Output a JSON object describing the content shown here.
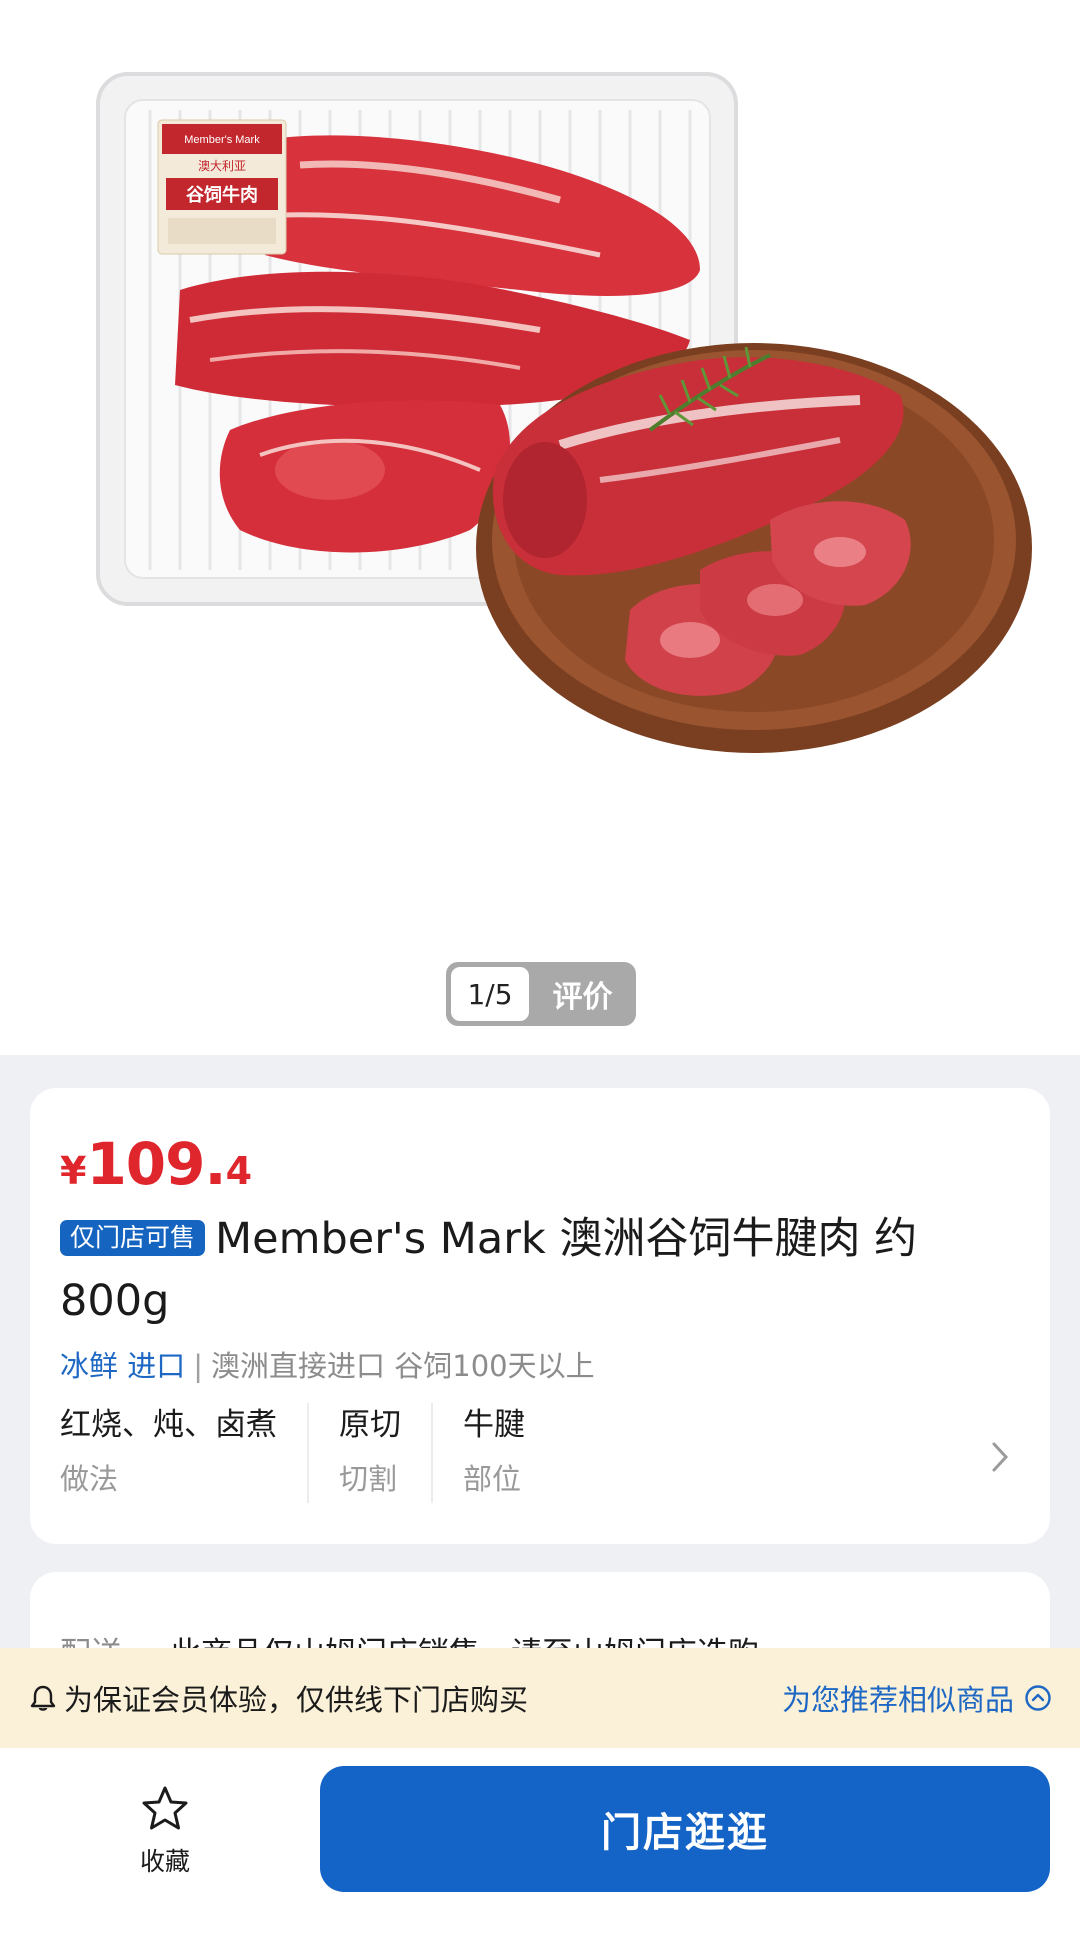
{
  "gallery": {
    "pager": {
      "current": "1/5",
      "reviews_label": "评价"
    },
    "package_label": {
      "brand": "Member's Mark",
      "line1": "澳大利亚",
      "line2": "谷饲牛肉"
    }
  },
  "product": {
    "price": {
      "currency": "¥",
      "integer": "109.",
      "decimal": "4"
    },
    "store_tag": "仅门店可售",
    "title": "Member's Mark 澳洲谷饲牛腱肉 约800g",
    "attributes": {
      "tag1": "冰鲜",
      "tag2": "进口",
      "separator": "|",
      "detail": "澳洲直接进口 谷饲100天以上"
    },
    "properties": [
      {
        "value": "红烧、炖、卤煮",
        "key": "做法"
      },
      {
        "value": "原切",
        "key": "切割"
      },
      {
        "value": "牛腱",
        "key": "部位"
      }
    ]
  },
  "delivery": {
    "label": "配送",
    "text": "此商品仅山姆门店销售，请至山姆门店选购"
  },
  "notice": {
    "message": "为保证会员体验，仅供线下门店购买",
    "link": "为您推荐相似商品"
  },
  "bottom_bar": {
    "favorite_label": "收藏",
    "store_button_label": "门店逛逛"
  },
  "colors": {
    "price": "#e0262d",
    "brand_blue": "#1463c6",
    "notice_bg": "#fbf1d8"
  }
}
